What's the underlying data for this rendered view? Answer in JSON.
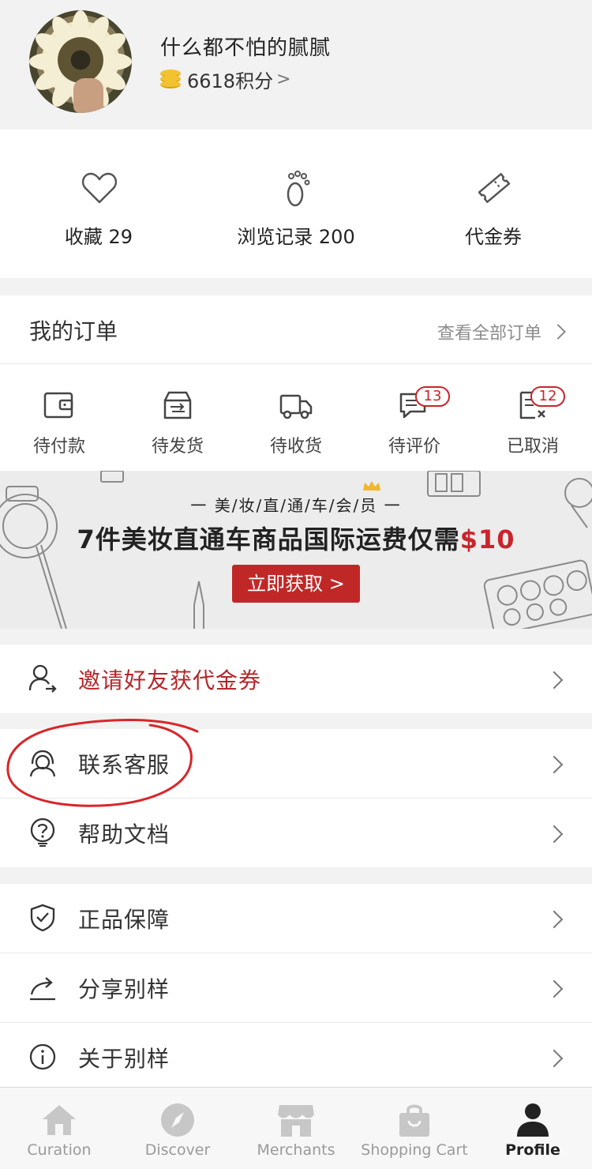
{
  "profile": {
    "username": "什么都不怕的腻腻",
    "points": "6618积分",
    "points_chevron": ">"
  },
  "stats": [
    {
      "icon": "heart-icon",
      "label": "收藏 29"
    },
    {
      "icon": "footprints-icon",
      "label": "浏览记录 200"
    },
    {
      "icon": "coupon-ticket-icon",
      "label": "代金券"
    }
  ],
  "orders": {
    "title": "我的订单",
    "view_all": "查看全部订单",
    "items": [
      {
        "icon": "wallet-icon",
        "label": "待付款",
        "badge": ""
      },
      {
        "icon": "box-icon",
        "label": "待发货",
        "badge": ""
      },
      {
        "icon": "truck-icon",
        "label": "待收货",
        "badge": ""
      },
      {
        "icon": "comment-icon",
        "label": "待评价",
        "badge": "13"
      },
      {
        "icon": "cancelled-doc-icon",
        "label": "已取消",
        "badge": "12"
      }
    ]
  },
  "banner": {
    "subtitle": "一 美/妆/直/通/车/会/员 一",
    "title_main": "7件美妆直通车商品国际运费仅需",
    "title_price": "$10",
    "button": "立即获取 >"
  },
  "menu": {
    "invite": "邀请好友获代金券",
    "support": "联系客服",
    "help": "帮助文档",
    "authentic": "正品保障",
    "share": "分享别样",
    "about": "关于别样"
  },
  "tabbar": [
    {
      "icon": "home-icon",
      "label": "Curation",
      "active": false
    },
    {
      "icon": "compass-icon",
      "label": "Discover",
      "active": false
    },
    {
      "icon": "store-icon",
      "label": "Merchants",
      "active": false
    },
    {
      "icon": "shopping-bag-icon",
      "label": "Shopping Cart",
      "active": false
    },
    {
      "icon": "user-icon",
      "label": "Profile",
      "active": true
    }
  ],
  "colors": {
    "accent_red": "#c02828",
    "badge_red": "#c9252b",
    "annotation_red": "#d8262a",
    "coin_gold": "#f3c230"
  }
}
